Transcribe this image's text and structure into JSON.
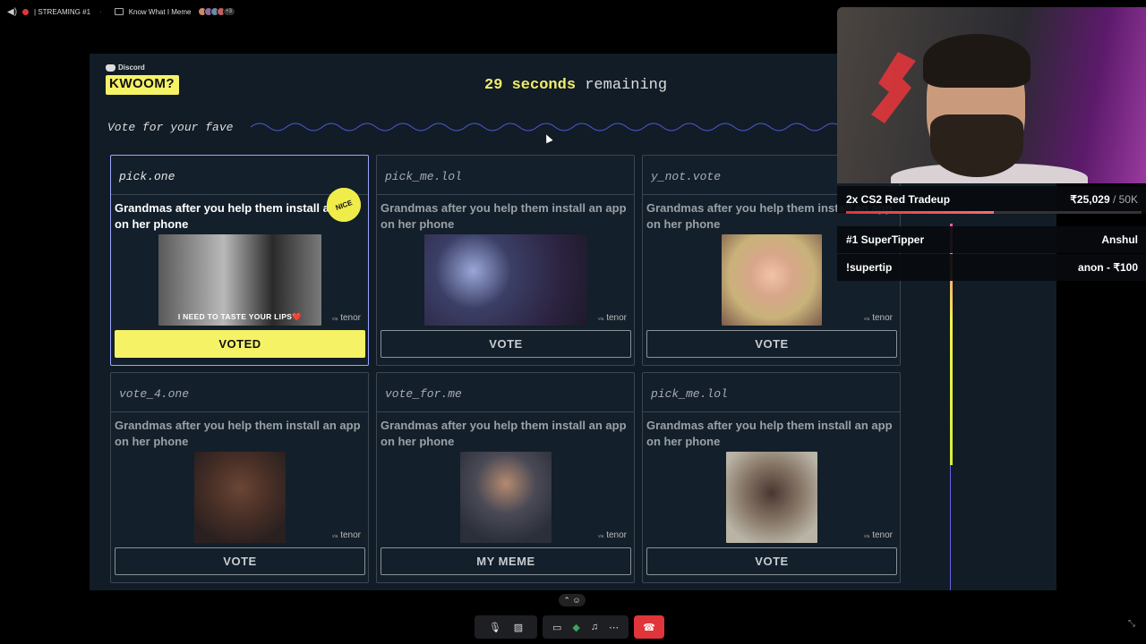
{
  "topbar": {
    "streaming_label": "| STREAMING #1",
    "activity_label": "Know What I Meme",
    "more_count": "+3"
  },
  "game": {
    "platform": "Discord",
    "logo_text": "KWOOM?",
    "timer_number": "29",
    "timer_seconds_text": "seconds",
    "timer_remaining_text": "remaining",
    "vote_heading": "Vote for your fave",
    "badge_text": "NICE",
    "cards": [
      {
        "user": "pick.one",
        "caption": "Grandmas after you help them install an app on her phone",
        "overlay": "I NEED TO TASTE YOUR LIPS❤️",
        "tenor": "tenor",
        "via": "via",
        "button": "VOTED"
      },
      {
        "user": "pick_me.lol",
        "caption": "Grandmas after you help them install an app on her phone",
        "overlay": "",
        "tenor": "tenor",
        "via": "via",
        "button": "VOTE"
      },
      {
        "user": "y_not.vote",
        "caption": "Grandmas after you help them install an app on her phone",
        "overlay": "",
        "tenor": "tenor",
        "via": "via",
        "button": "VOTE"
      },
      {
        "user": "vote_4.one",
        "caption": "Grandmas after you help them install an app on her phone",
        "overlay": "",
        "tenor": "tenor",
        "via": "via",
        "button": "VOTE"
      },
      {
        "user": "vote_for.me",
        "caption": "Grandmas after you help them install an app on her phone",
        "overlay": "",
        "tenor": "tenor",
        "via": "via",
        "button": "MY MEME"
      },
      {
        "user": "pick_me.lol",
        "caption": "Grandmas after you help them install an app on her phone",
        "overlay": "",
        "tenor": "tenor",
        "via": "via",
        "button": "VOTE"
      }
    ]
  },
  "stream_overlay": {
    "goal_name": "2x CS2 Red Tradeup",
    "goal_amount": "₹25,029",
    "goal_target": "/ 50K",
    "goal_progress": 0.5,
    "top_tipper_label": "#1 SuperTipper",
    "top_tipper_name": "Anshul",
    "supertip_label": "!supertip",
    "supertip_value": "anon - ₹100"
  },
  "colors": {
    "accent_yellow": "#f5f266",
    "end_call_red": "#e0353b",
    "stage_bg": "#111c26"
  },
  "icons": [
    "volume-icon",
    "live-dot-icon",
    "activity-icon",
    "discord-icon",
    "cursor-icon",
    "mic-icon",
    "camera-off-icon",
    "screen-share-icon",
    "activities-icon",
    "soundboard-icon",
    "more-icon",
    "end-call-icon",
    "fullscreen-icon"
  ]
}
